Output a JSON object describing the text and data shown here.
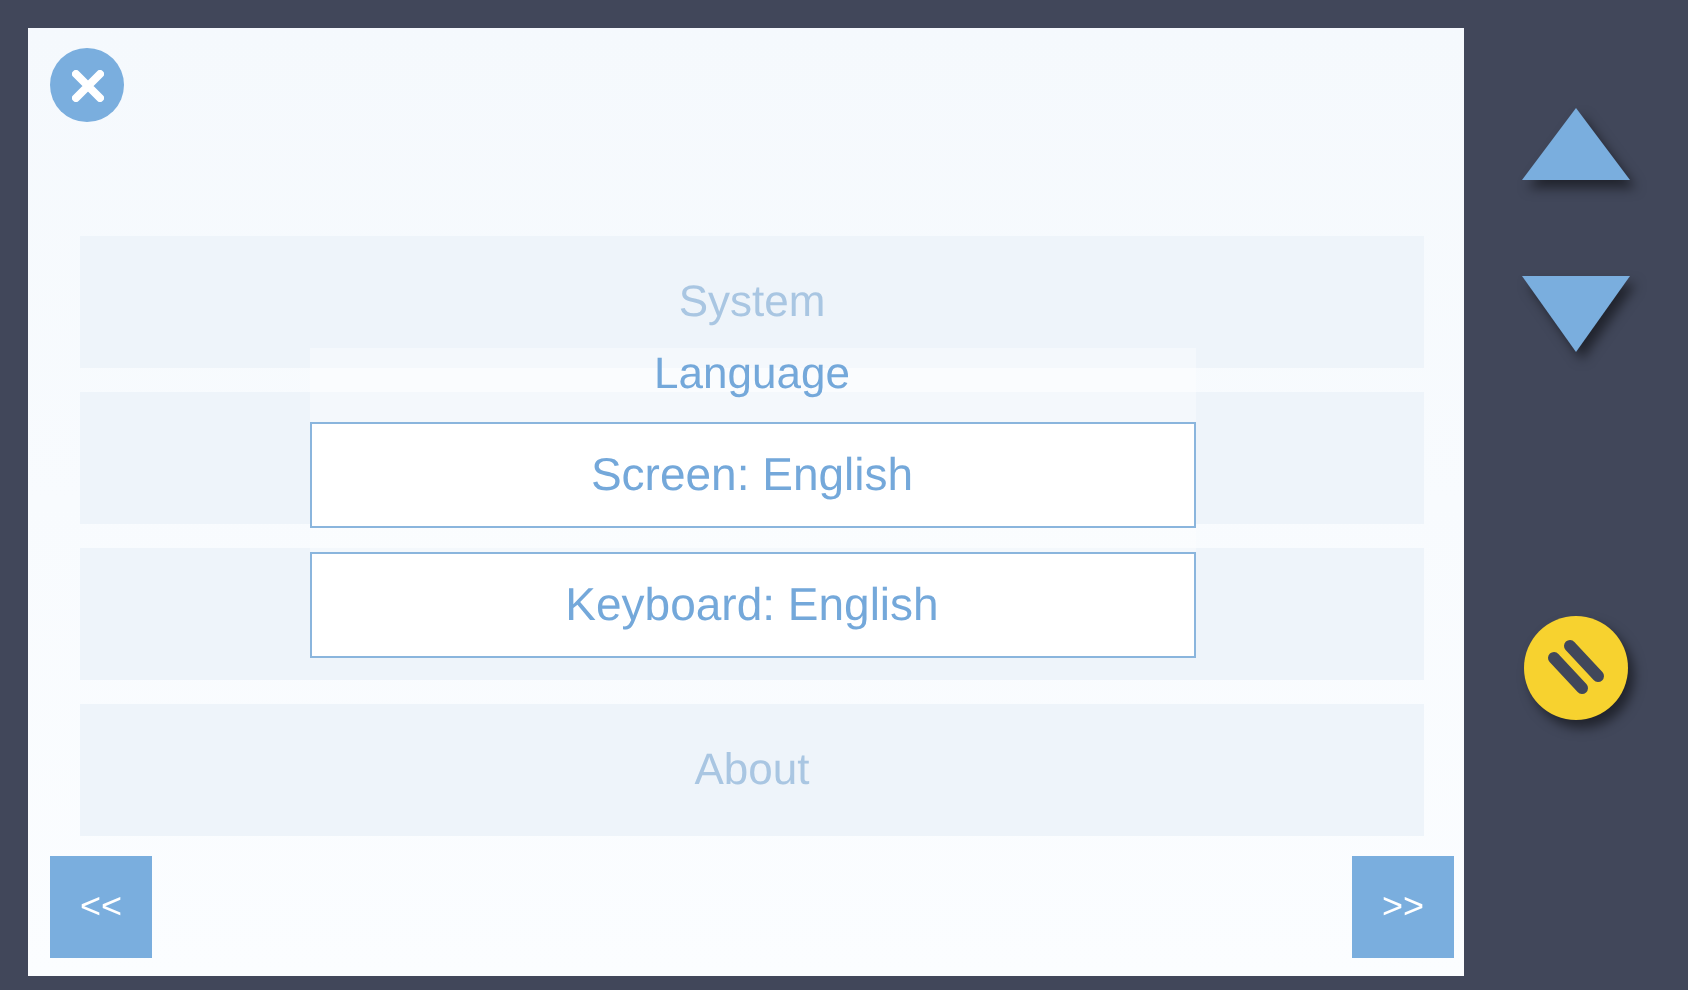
{
  "background_menu": [
    {
      "kind": "labeled",
      "label": "System"
    },
    {
      "kind": "blank"
    },
    {
      "kind": "blank"
    },
    {
      "kind": "labeled",
      "label": "About"
    }
  ],
  "dialog": {
    "title": "Language",
    "options": [
      {
        "label": "Screen: English"
      },
      {
        "label": "Keyboard: English"
      }
    ]
  },
  "nav": {
    "previous": "<<",
    "next": ">>"
  }
}
